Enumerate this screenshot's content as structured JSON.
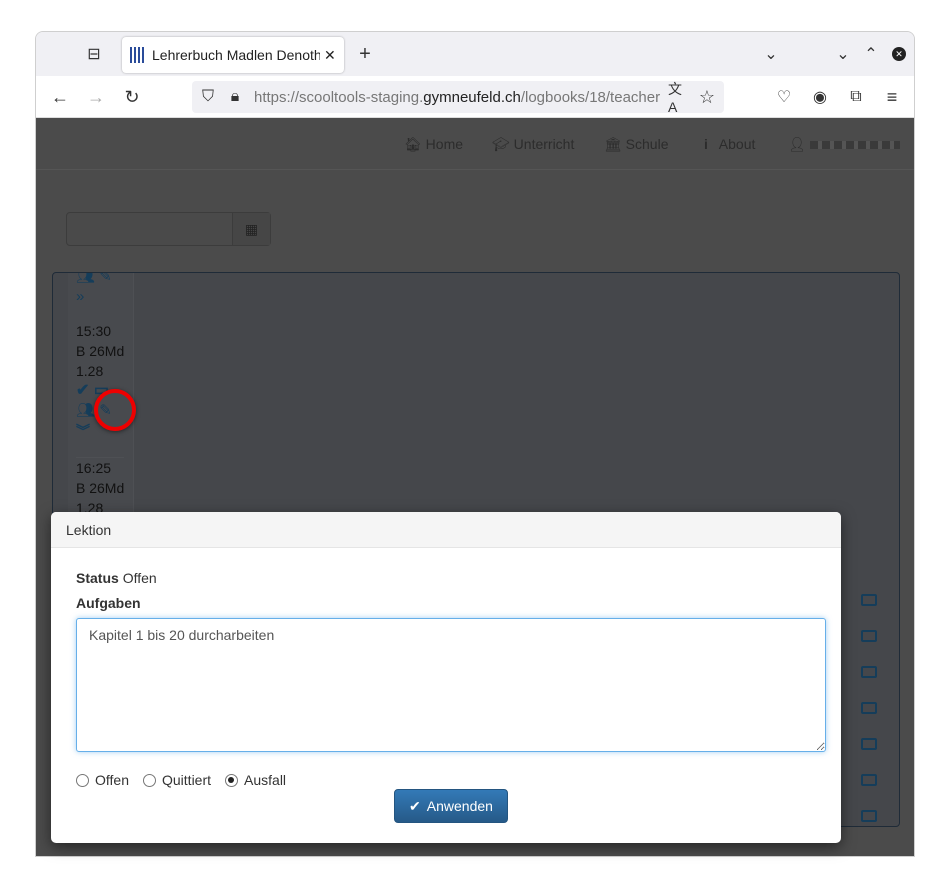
{
  "browser": {
    "tab_title": "Lehrerbuch Madlen Denoth",
    "url_prefix": "https://scooltools-staging.",
    "url_domain": "gymneufeld.ch",
    "url_path": "/logbooks/18/teacher"
  },
  "topnav": {
    "items": [
      {
        "icon": "home-icon",
        "label": "Home"
      },
      {
        "icon": "graduation-cap-icon",
        "label": "Unterricht"
      },
      {
        "icon": "school-icon",
        "label": "Schule"
      },
      {
        "icon": "info-icon",
        "label": "About"
      }
    ],
    "user_icon": "user-icon"
  },
  "lessons": [
    {
      "time": "15:30",
      "room": "B 26Md",
      "class": "1.28"
    },
    {
      "time": "16:25",
      "room": "B 26Md",
      "class": "1.28"
    }
  ],
  "modal": {
    "title": "Lektion",
    "status_label": "Status",
    "status_value": "Offen",
    "tasks_label": "Aufgaben",
    "tasks_value": "Kapitel 1 bis 20 durcharbeiten",
    "radio_options": [
      "Offen",
      "Quittiert",
      "Ausfall"
    ],
    "selected": "Ausfall",
    "apply_label": "Anwenden"
  },
  "colors": {
    "accent": "#337ab7",
    "highlight": "#ee0000"
  }
}
